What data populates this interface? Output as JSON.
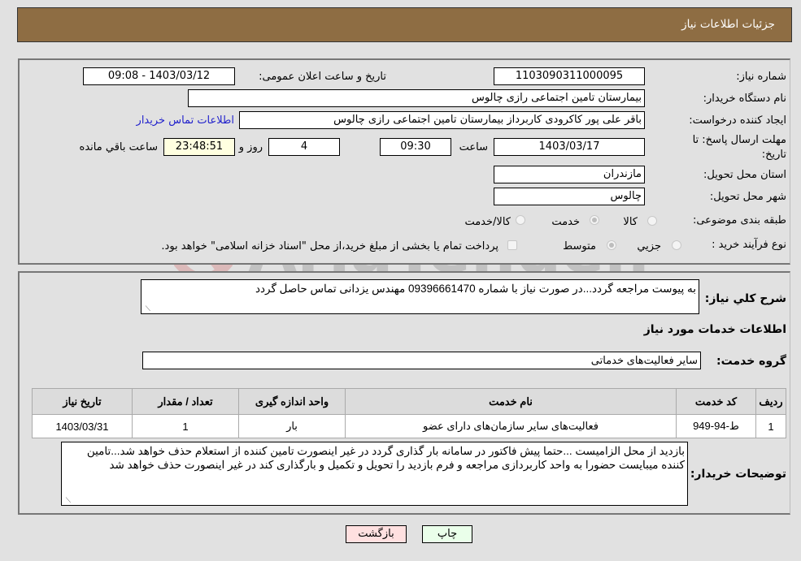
{
  "header": {
    "title": "جزئیات اطلاعات نیاز"
  },
  "details": {
    "need_number_label": "شماره نیاز:",
    "need_number": "1103090311000095",
    "announce_label": "تاریخ و ساعت اعلان عمومی:",
    "announce_value": "1403/03/12 - 09:08",
    "buyer_org_label": "نام دستگاه خریدار:",
    "buyer_org": "بیمارستان تامین اجتماعی رازی چالوس",
    "creator_label": "ایجاد کننده درخواست:",
    "creator": "باقر علی پور کاکرودی کاربرداز بیمارستان تامین اجتماعی رازی چالوس",
    "contact_link": "اطلاعات تماس خریدار",
    "deadline_label_1": "مهلت ارسال پاسخ: تا",
    "deadline_label_2": "تاریخ:",
    "deadline_date": "1403/03/17",
    "time_label": "ساعت",
    "deadline_time": "09:30",
    "days_value": "4",
    "days_label": "روز و",
    "remaining_time": "23:48:51",
    "remaining_label": "ساعت باقي مانده",
    "province_label": "استان محل تحویل:",
    "province": "مازندران",
    "city_label": "شهر محل تحویل:",
    "city": "چالوس",
    "category_label": "طبقه بندی موضوعی:",
    "category_options": [
      "کالا",
      "خدمت",
      "کالا/خدمت"
    ],
    "category_selected": "خدمت",
    "process_label": "نوع فرآیند خرید :",
    "process_options": [
      "جزيي",
      "متوسط"
    ],
    "process_selected": "متوسط",
    "treasury_checkbox_label": "پرداخت تمام یا بخشی از مبلغ خرید،از محل \"اسناد خزانه اسلامی\" خواهد بود."
  },
  "description": {
    "label": "شرح کلي نياز:",
    "text": "به پیوست مراجعه گردد...در صورت نیاز با شماره 09396661470 مهندس یزدانی تماس حاصل گردد"
  },
  "services": {
    "section_title": "اطلاعات خدمات مورد نیاز",
    "group_label": "گروه خدمت:",
    "group_value": "سایر فعالیت‌های خدماتی",
    "columns": [
      "ردیف",
      "کد خدمت",
      "نام خدمت",
      "واحد اندازه گیری",
      "تعداد / مقدار",
      "تاریخ نیاز"
    ],
    "rows": [
      [
        "1",
        "ط-94-949",
        "فعالیت‌های سایر سازمان‌های دارای عضو",
        "بار",
        "1",
        "1403/03/31"
      ]
    ]
  },
  "buyer_notes": {
    "label": "توضیحات خریدار:",
    "text": "بازدید از محل الزامیست ...حتما پیش فاکتور  در سامانه بار گذاری گردد در غیر اینصورت تامین کننده از استعلام حذف خواهد شد...تامین کننده میبایست حضورا به واحد کاربردازی مراجعه و فرم بازدید را تحویل و تکمیل و بارگذاری کند در غیر اینصورت حذف خواهد شد"
  },
  "buttons": {
    "print": "چاپ",
    "back": "بازگشت"
  },
  "watermark": {
    "text": "AriaTender.neT"
  },
  "colors": {
    "header_bg": "#8e6d43",
    "print_bg": "#eaffea",
    "back_bg": "#ffe0e0",
    "link": "#2222cc"
  }
}
